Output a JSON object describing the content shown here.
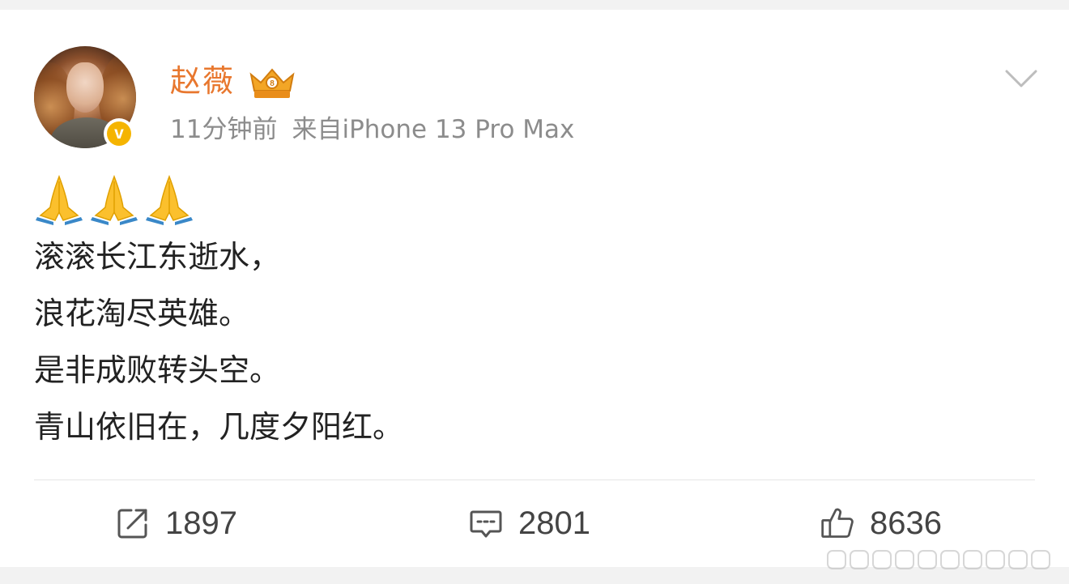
{
  "post": {
    "author": {
      "name": "赵薇",
      "verified_icon": "verified-v-icon",
      "verified_mark": "v",
      "badge_icon": "crown-badge-icon"
    },
    "meta": {
      "time": "11分钟前",
      "source": "来自iPhone 13 Pro Max"
    },
    "content": {
      "emojis": [
        "🙏",
        "🙏",
        "🙏"
      ],
      "lines": [
        "滚滚长江东逝水，",
        "浪花淘尽英雄。",
        "是非成败转头空。",
        "青山依旧在，几度夕阳红。"
      ]
    },
    "actions": {
      "repost": {
        "icon": "repost-icon",
        "count": "1897"
      },
      "comment": {
        "icon": "comment-icon",
        "count": "2801"
      },
      "like": {
        "icon": "thumbs-up-icon",
        "count": "8636"
      }
    }
  },
  "colors": {
    "username": "#e8772e",
    "verified": "#f5b400",
    "text": "#222222",
    "meta": "#8c8c8c"
  }
}
